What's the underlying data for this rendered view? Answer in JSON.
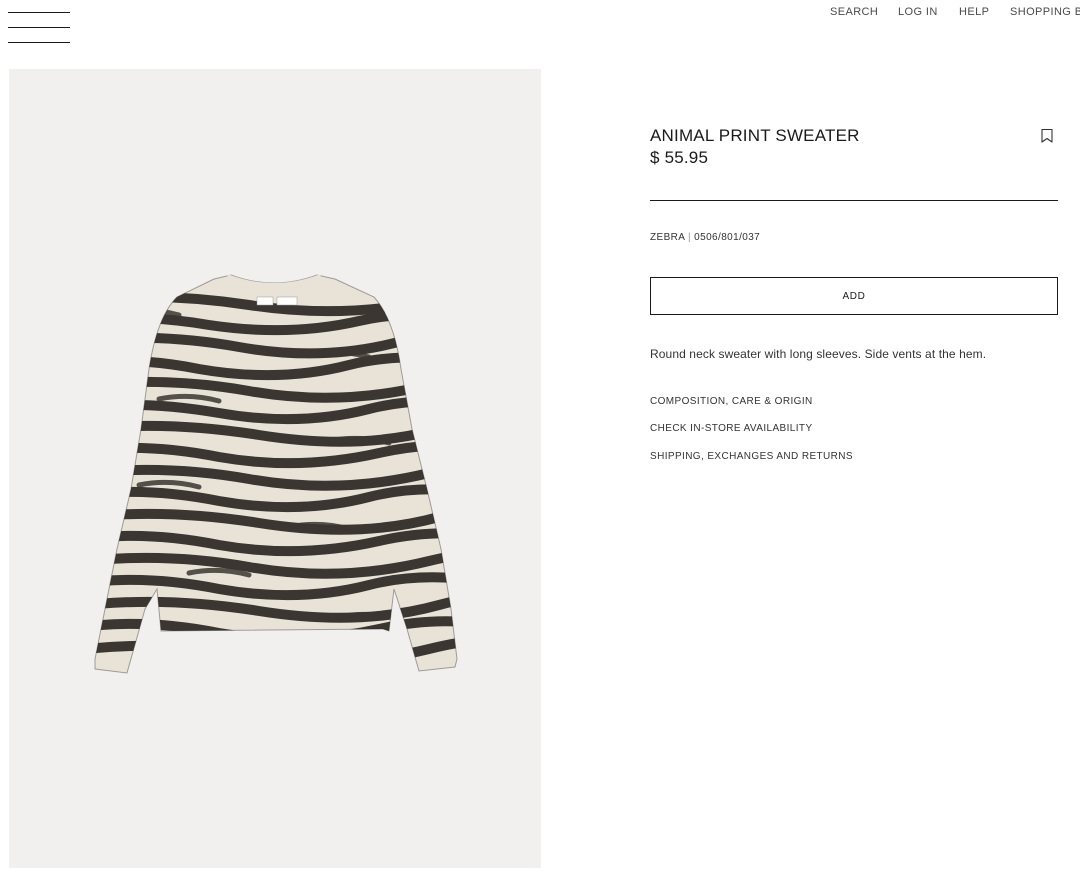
{
  "nav": {
    "menu_icon": "hamburger-icon",
    "items": [
      "SEARCH",
      "LOG IN",
      "HELP",
      "SHOPPING B"
    ]
  },
  "product": {
    "title": "ANIMAL PRINT SWEATER",
    "price": "$ 55.95",
    "color_name": "ZEBRA",
    "separator": "|",
    "reference": "0506/801/037",
    "add_label": "ADD",
    "description": "Round neck sweater with long sleeves. Side vents at the hem.",
    "bookmark_icon": "bookmark-icon",
    "links": [
      "COMPOSITION, CARE & ORIGIN",
      "CHECK IN-STORE AVAILABILITY",
      "SHIPPING, EXCHANGES AND RETURNS"
    ]
  },
  "image": {
    "background": "#f1f0ee",
    "stripe_color": "#3b3631",
    "base_color": "#e8e3d6"
  }
}
